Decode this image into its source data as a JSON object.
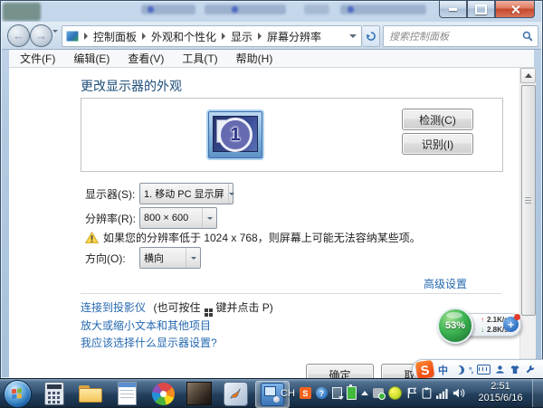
{
  "window": {
    "breadcrumb": [
      "控制面板",
      "外观和个性化",
      "显示",
      "屏幕分辨率"
    ],
    "search_placeholder": "搜索控制面板",
    "menu": [
      "文件(F)",
      "编辑(E)",
      "查看(V)",
      "工具(T)",
      "帮助(H)"
    ]
  },
  "content": {
    "heading": "更改显示器的外观",
    "detect_button": "检测(C)",
    "identify_button": "识别(I)",
    "monitor_number": "1",
    "display_label": "显示器(S):",
    "display_value": "1. 移动 PC 显示屏",
    "resolution_label": "分辨率(R):",
    "resolution_value": "800 × 600",
    "warning_text": "如果您的分辨率低于 1024 x 768，则屏幕上可能无法容纳某些项。",
    "orientation_label": "方向(O):",
    "orientation_value": "横向",
    "advanced_link": "高级设置",
    "projector_link": "连接到投影仪",
    "projector_hint_prefix": "(也可按住",
    "projector_hint_suffix": "键并点击 P)",
    "magnify_link": "放大或缩小文本和其他项目",
    "which_settings_link": "我应该选择什么显示器设置?",
    "ok_button": "确定",
    "cancel_button": "取消"
  },
  "overlay": {
    "speed_percent": "53%",
    "upload_speed": "2.1K/s",
    "download_speed": "2.8K/s",
    "up_arrow": "↑",
    "down_arrow": "↓",
    "ime_logo": "S",
    "ime_mode": "中",
    "ime_punct": "°,"
  },
  "taskbar": {
    "lang_indicator": "CH",
    "sogou_tray_glyph": "S",
    "qq_tray_glyph": "?",
    "time": "2:51",
    "date": "2015/6/16"
  },
  "colors": {
    "link_blue": "#2569b0",
    "heading_blue": "#1e4e79",
    "aero_glass": "#b4cbe2",
    "taskbar_blue": "#33516f",
    "close_red": "#c6472b",
    "ball_green": "#3cb452",
    "sogou_orange": "#f2641e"
  }
}
